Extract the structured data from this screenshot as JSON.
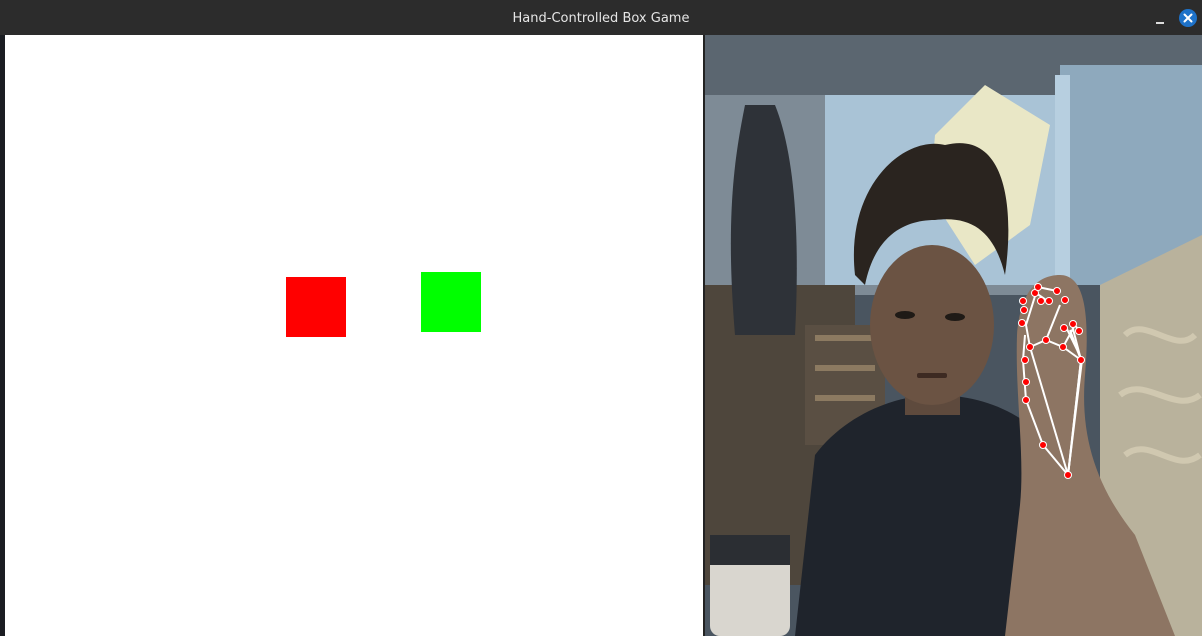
{
  "window": {
    "title": "Hand-Controlled Box Game"
  },
  "icons": {
    "minimize": "minimize-icon",
    "close": "close-icon"
  },
  "colors": {
    "titlebar": "#2c2c2c",
    "close_button": "#1e72c9",
    "game_background": "#ffffff",
    "red_box": "#ff0000",
    "green_box": "#00ff00",
    "hand_landmark": "#ff0000",
    "hand_connection": "#ffffff"
  },
  "game": {
    "boxes": [
      {
        "name": "red",
        "color": "#ff0000"
      },
      {
        "name": "green",
        "color": "#00ff00"
      }
    ]
  },
  "camera": {
    "hand_landmarks_detected": 21
  }
}
